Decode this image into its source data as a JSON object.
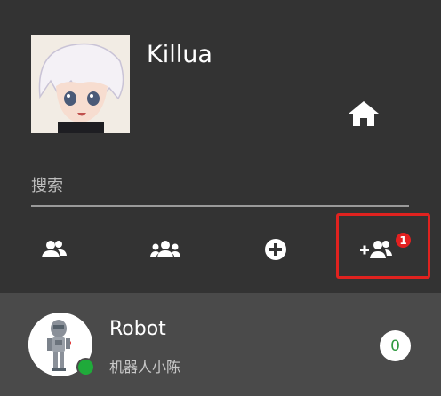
{
  "profile": {
    "name": "Killua"
  },
  "search": {
    "placeholder": "搜索"
  },
  "tabs": [
    {
      "icon": "contacts-icon"
    },
    {
      "icon": "group-icon"
    },
    {
      "icon": "add-circle-icon"
    },
    {
      "icon": "add-friend-icon",
      "badge": "1"
    }
  ],
  "contacts": [
    {
      "name": "Robot",
      "subtitle": "机器人小陈",
      "unread": "0",
      "online": true,
      "status_color": "#1faa3a"
    }
  ],
  "colors": {
    "background": "#333333",
    "list_bg": "#4a4a4a",
    "badge_red": "#e32020",
    "highlight_red": "#e0221f"
  }
}
